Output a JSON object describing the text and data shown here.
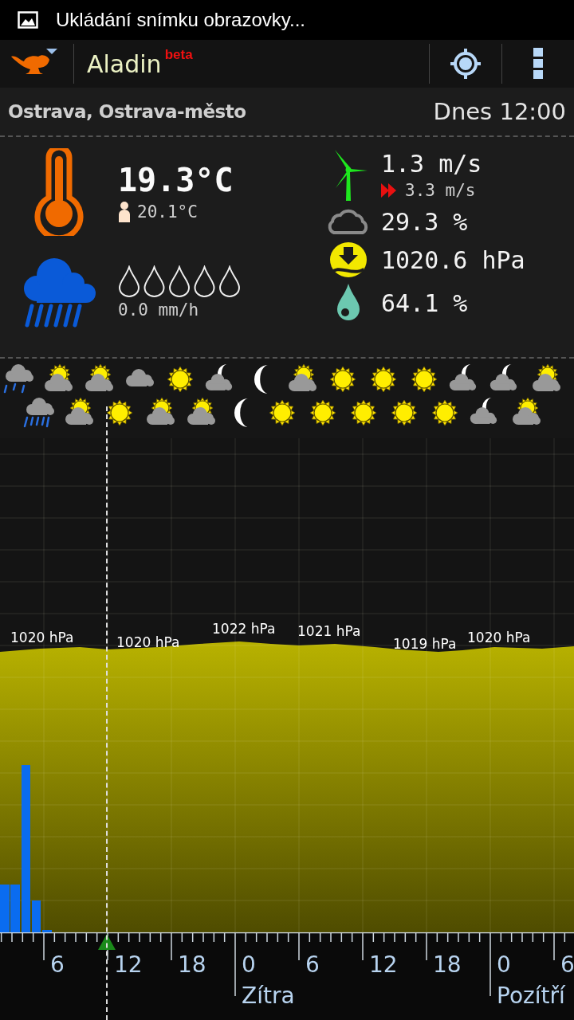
{
  "status_bar": {
    "notification": "Ukládání snímku obrazovky..."
  },
  "action_bar": {
    "title": "Aladin",
    "badge": "beta"
  },
  "location": {
    "place": "Ostrava, Ostrava-město",
    "time": "Dnes 12:00"
  },
  "current": {
    "temperature": "19.3°C",
    "feels_like": "20.1°C",
    "precipitation": {
      "reading": "0.0 mm/h"
    },
    "wind": "1.3 m/s",
    "gusts": "3.3 m/s",
    "cloudiness": "29.3 %",
    "pressure": "1020.6 hPa",
    "humidity": "64.1 %"
  },
  "forecast_icons": {
    "row_1": [
      {
        "kind": "rain"
      },
      {
        "kind": "sun-cloud"
      },
      {
        "kind": "sun-cloud"
      },
      {
        "kind": "cloud"
      },
      {
        "kind": "sun"
      },
      {
        "kind": "moon-cloud"
      },
      {
        "kind": "moon"
      },
      {
        "kind": "sun-cloud"
      },
      {
        "kind": "sun"
      },
      {
        "kind": "sun"
      },
      {
        "kind": "sun"
      },
      {
        "kind": "moon-cloud"
      },
      {
        "kind": "moon-cloud"
      },
      {
        "kind": "sun-cloud"
      }
    ],
    "row_2": [
      {
        "kind": "heavy-rain"
      },
      {
        "kind": "sun-cloud"
      },
      {
        "kind": "sun"
      },
      {
        "kind": "sun-cloud"
      },
      {
        "kind": "sun-cloud"
      },
      {
        "kind": "moon"
      },
      {
        "kind": "sun"
      },
      {
        "kind": "sun"
      },
      {
        "kind": "sun"
      },
      {
        "kind": "sun"
      },
      {
        "kind": "sun"
      },
      {
        "kind": "moon-cloud"
      },
      {
        "kind": "sun-cloud"
      }
    ]
  },
  "chart": {
    "pressure_labels": [
      "1020 hPa",
      "1020 hPa",
      "1022 hPa",
      "1021 hPa",
      "1019 hPa",
      "1020 hPa"
    ],
    "hour_labels": [
      "6",
      "12",
      "18",
      "0",
      "6",
      "12",
      "18",
      "0",
      "6"
    ],
    "day_labels": [
      "Zítra",
      "Pozítří"
    ]
  }
}
